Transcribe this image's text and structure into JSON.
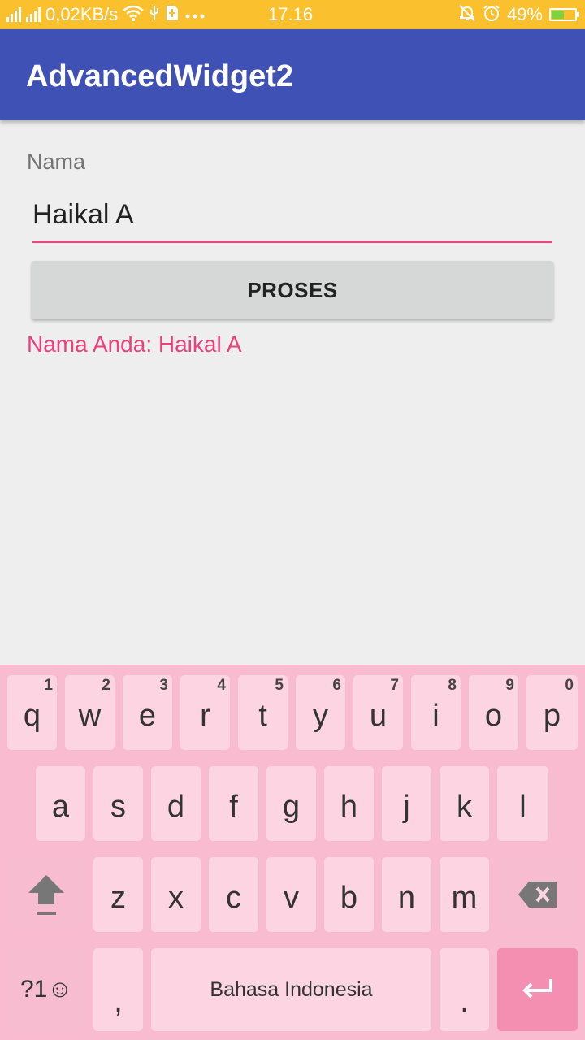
{
  "status_bar": {
    "speed": "0,02KB/s",
    "time": "17.16",
    "battery": "49%",
    "icons": [
      "signal-icon",
      "signal-icon",
      "wifi-icon",
      "usb-icon",
      "sim-icon",
      "more-icon",
      "mute-icon",
      "alarm-icon",
      "battery-icon"
    ]
  },
  "app_bar": {
    "title": "AdvancedWidget2"
  },
  "form": {
    "label": "Nama",
    "input_value": "Haikal A",
    "button_label": "PROSES",
    "result_text": "Nama Anda: Haikal A"
  },
  "colors": {
    "status_bar": "#fbc02d",
    "app_bar": "#3f51b5",
    "accent": "#ec407a",
    "keyboard_bg": "#f8bbd0",
    "key": "#fcd4e2",
    "enter_key": "#f48fb1"
  },
  "keyboard": {
    "row1": [
      {
        "ch": "q",
        "num": "1"
      },
      {
        "ch": "w",
        "num": "2"
      },
      {
        "ch": "e",
        "num": "3"
      },
      {
        "ch": "r",
        "num": "4"
      },
      {
        "ch": "t",
        "num": "5"
      },
      {
        "ch": "y",
        "num": "6"
      },
      {
        "ch": "u",
        "num": "7"
      },
      {
        "ch": "i",
        "num": "8"
      },
      {
        "ch": "o",
        "num": "9"
      },
      {
        "ch": "p",
        "num": "0"
      }
    ],
    "row2": [
      "a",
      "s",
      "d",
      "f",
      "g",
      "h",
      "j",
      "k",
      "l"
    ],
    "row3": [
      "z",
      "x",
      "c",
      "v",
      "b",
      "n",
      "m"
    ],
    "symbols_label": "?1☺",
    "comma": ",",
    "space_label": "Bahasa Indonesia",
    "period": "."
  }
}
